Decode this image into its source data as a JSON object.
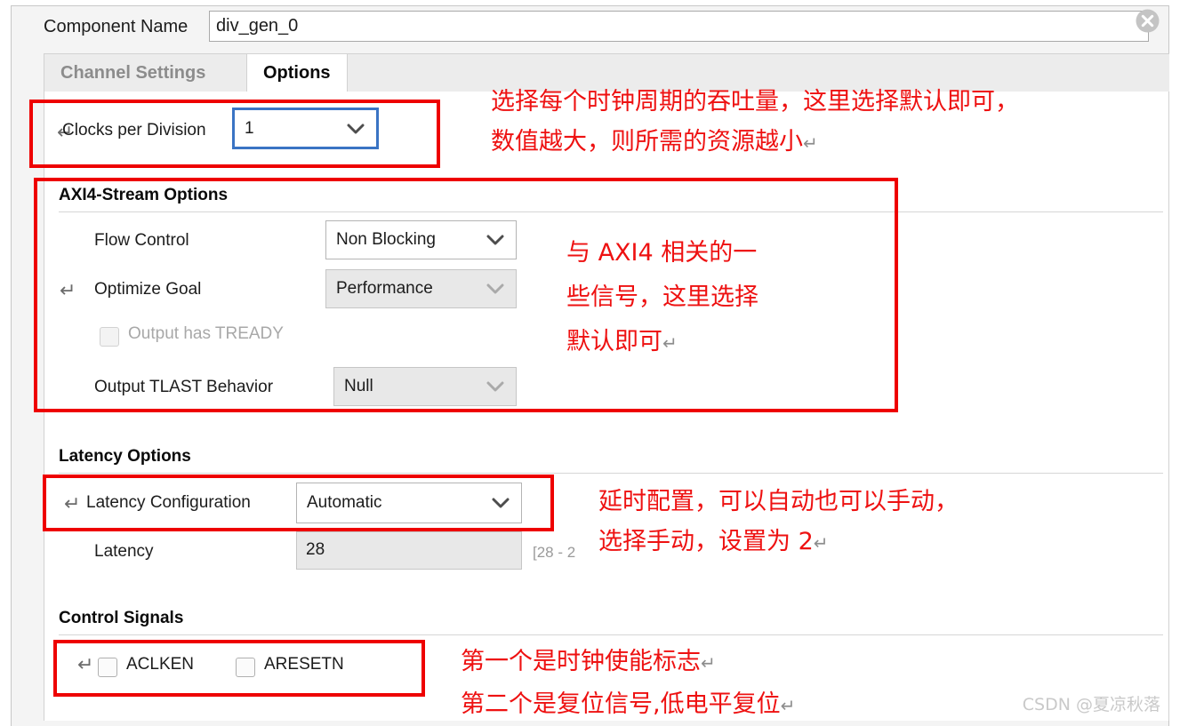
{
  "dialog": {
    "component_name_label": "Component Name",
    "component_name_value": "div_gen_0",
    "close_icon": "close-circle-icon"
  },
  "tabs": [
    {
      "label": "Channel Settings",
      "active": false
    },
    {
      "label": "Options",
      "active": true
    }
  ],
  "clocks_per_division": {
    "label": "Clocks per Division",
    "value": "1"
  },
  "axi4_stream": {
    "title": "AXI4-Stream Options",
    "flow_control": {
      "label": "Flow Control",
      "value": "Non Blocking"
    },
    "optimize_goal": {
      "label": "Optimize Goal",
      "value": "Performance"
    },
    "output_has_tready": {
      "label": "Output has TREADY",
      "checked": false
    },
    "output_tlast_behavior": {
      "label": "Output TLAST Behavior",
      "value": "Null"
    }
  },
  "latency": {
    "title": "Latency Options",
    "configuration": {
      "label": "Latency Configuration",
      "value": "Automatic"
    },
    "value_label": "Latency",
    "value": "28",
    "range_hint": "[28 - 2"
  },
  "control_signals": {
    "title": "Control Signals",
    "aclken": {
      "label": "ACLKEN",
      "checked": false
    },
    "aresetn": {
      "label": "ARESETN",
      "checked": false
    }
  },
  "annotations": {
    "clocks_line1": "选择每个时钟周期的吞吐量，这里选择默认即可，",
    "clocks_line2": "数值越大，则所需的资源越小",
    "axi_line1": "与 AXI4 相关的一",
    "axi_line2": "些信号，这里选择",
    "axi_line3": "默认即可",
    "latency_line1": "延时配置，可以自动也可以手动，",
    "latency_line2": "选择手动，设置为 2",
    "control_line1": "第一个是时钟使能标志",
    "control_line2": "第二个是复位信号,低电平复位",
    "return_mark": "↵"
  },
  "watermark": "CSDN @夏凉秋落",
  "colors": {
    "annotation_red": "#ee1111",
    "box_red": "#ee0000",
    "focus_blue": "#3a74c4"
  }
}
